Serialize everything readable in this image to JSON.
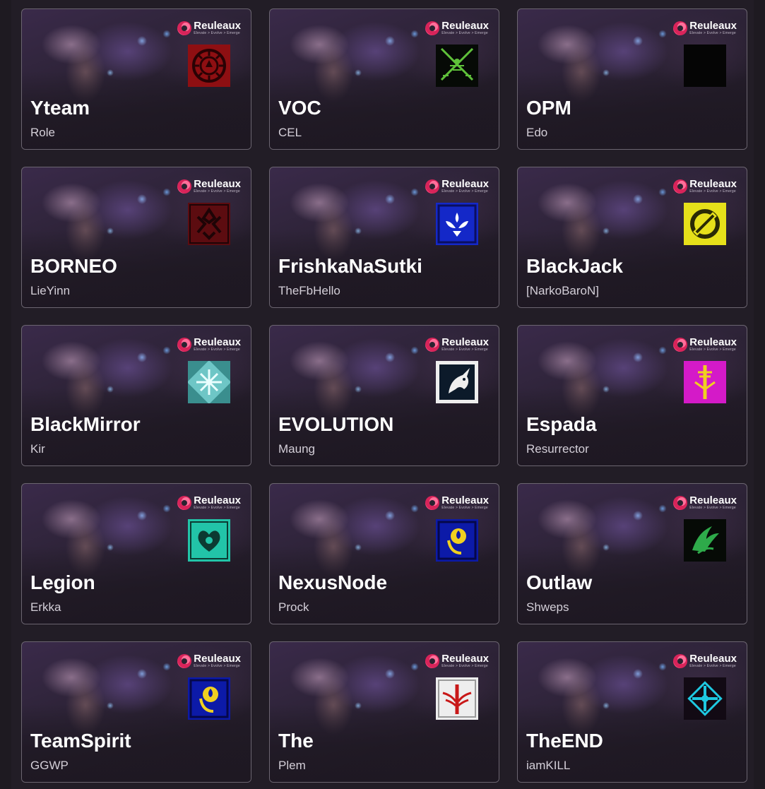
{
  "brand": {
    "name": "Reuleaux",
    "tagline": "Elevate > Evolve > Emerge"
  },
  "teams": [
    {
      "name": "Yteam",
      "captain": "Role",
      "emblem": "red-gear-emblem-icon"
    },
    {
      "name": "VOC",
      "captain": "CEL",
      "emblem": "green-crossed-swords-emblem-icon"
    },
    {
      "name": "OPM",
      "captain": "Edo",
      "emblem": "black-blank-emblem-icon"
    },
    {
      "name": "BORNEO",
      "captain": "LieYinn",
      "emblem": "dark-red-tribal-emblem-icon"
    },
    {
      "name": "FrishkaNaSutki",
      "captain": "TheFbHello",
      "emblem": "blue-phoenix-emblem-icon"
    },
    {
      "name": "BlackJack",
      "captain": "[NarkoBaroN]",
      "emblem": "yellow-blade-emblem-icon"
    },
    {
      "name": "BlackMirror",
      "captain": "Kir",
      "emblem": "teal-crystal-emblem-icon"
    },
    {
      "name": "EVOLUTION",
      "captain": "Maung",
      "emblem": "white-unicorn-emblem-icon"
    },
    {
      "name": "Espada",
      "captain": "Resurrector",
      "emblem": "magenta-sword-emblem-icon"
    },
    {
      "name": "Legion",
      "captain": "Erkka",
      "emblem": "turquoise-heart-emblem-icon"
    },
    {
      "name": "NexusNode",
      "captain": "Prock",
      "emblem": "blue-yellow-rose-emblem-icon"
    },
    {
      "name": "Outlaw",
      "captain": "Shweps",
      "emblem": "green-wings-emblem-icon"
    },
    {
      "name": "TeamSpirit",
      "captain": "GGWP",
      "emblem": "blue-yellow-rose-emblem-icon"
    },
    {
      "name": "The",
      "captain": "Plem",
      "emblem": "red-winged-sword-emblem-icon"
    },
    {
      "name": "TheEND",
      "captain": "iamKILL",
      "emblem": "cyan-cross-emblem-icon"
    }
  ]
}
